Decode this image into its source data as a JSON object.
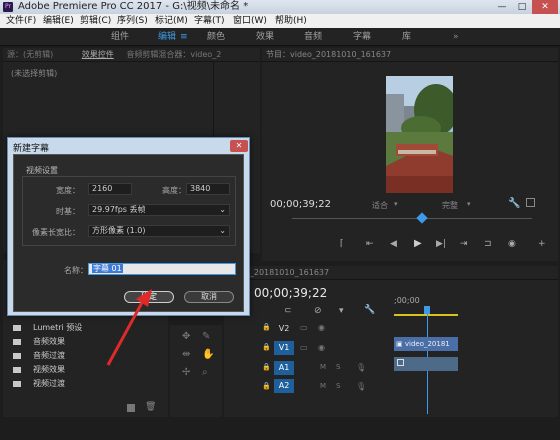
{
  "titlebar": {
    "title": "Adobe Premiere Pro CC 2017 - G:\\视频\\未命名 *",
    "minimize": "—",
    "maximize": "□",
    "close": "✕"
  },
  "menu": [
    "文件(F)",
    "编辑(E)",
    "剪辑(C)",
    "序列(S)",
    "标记(M)",
    "字幕(T)",
    "窗口(W)",
    "帮助(H)"
  ],
  "workspace_tabs": [
    {
      "label": "组件",
      "active": false
    },
    {
      "label": "编辑",
      "active": true
    },
    {
      "label": "颜色",
      "active": false
    },
    {
      "label": "效果",
      "active": false
    },
    {
      "label": "音频",
      "active": false
    },
    {
      "label": "字幕",
      "active": false
    },
    {
      "label": "库",
      "active": false
    }
  ],
  "source_panel": {
    "tabs": [
      "源：(无剪辑)",
      "效果控件",
      "音频剪辑混合器：video_2"
    ],
    "no_clip": "(未选择剪辑)"
  },
  "program_monitor": {
    "title": "节目：video_20181010_161637",
    "timecode": "00;00;39;22",
    "fit": "适合",
    "quality": "完整"
  },
  "dialog": {
    "title": "新建字幕",
    "close": "✕",
    "section": "视频设置",
    "width_label": "宽度：",
    "width_value": "2160",
    "height_label": "高度：",
    "height_value": "3840",
    "timebase_label": "时基：",
    "timebase_value": "29.97fps 丢帧",
    "par_label": "像素长宽比：",
    "par_value": "方形像素 (1.0)",
    "name_label": "名称：",
    "name_value": "字幕 01",
    "ok": "确定",
    "cancel": "取消"
  },
  "timeline": {
    "tab": "video_20181010_161637",
    "timecode": "00;00;39;22",
    "ruler": ";00;00",
    "tracks": [
      "V2",
      "V1",
      "A1",
      "A2"
    ],
    "clip_label": "video_20181"
  },
  "project_tree": [
    "Lumetri 预设",
    "音频效果",
    "音频过渡",
    "视频效果",
    "视频过渡"
  ],
  "colors": {
    "accent": "#3d9ae8",
    "playhead": "#3d9ae8",
    "clip": "#4a6ea8",
    "arrow": "#e02a2a"
  }
}
